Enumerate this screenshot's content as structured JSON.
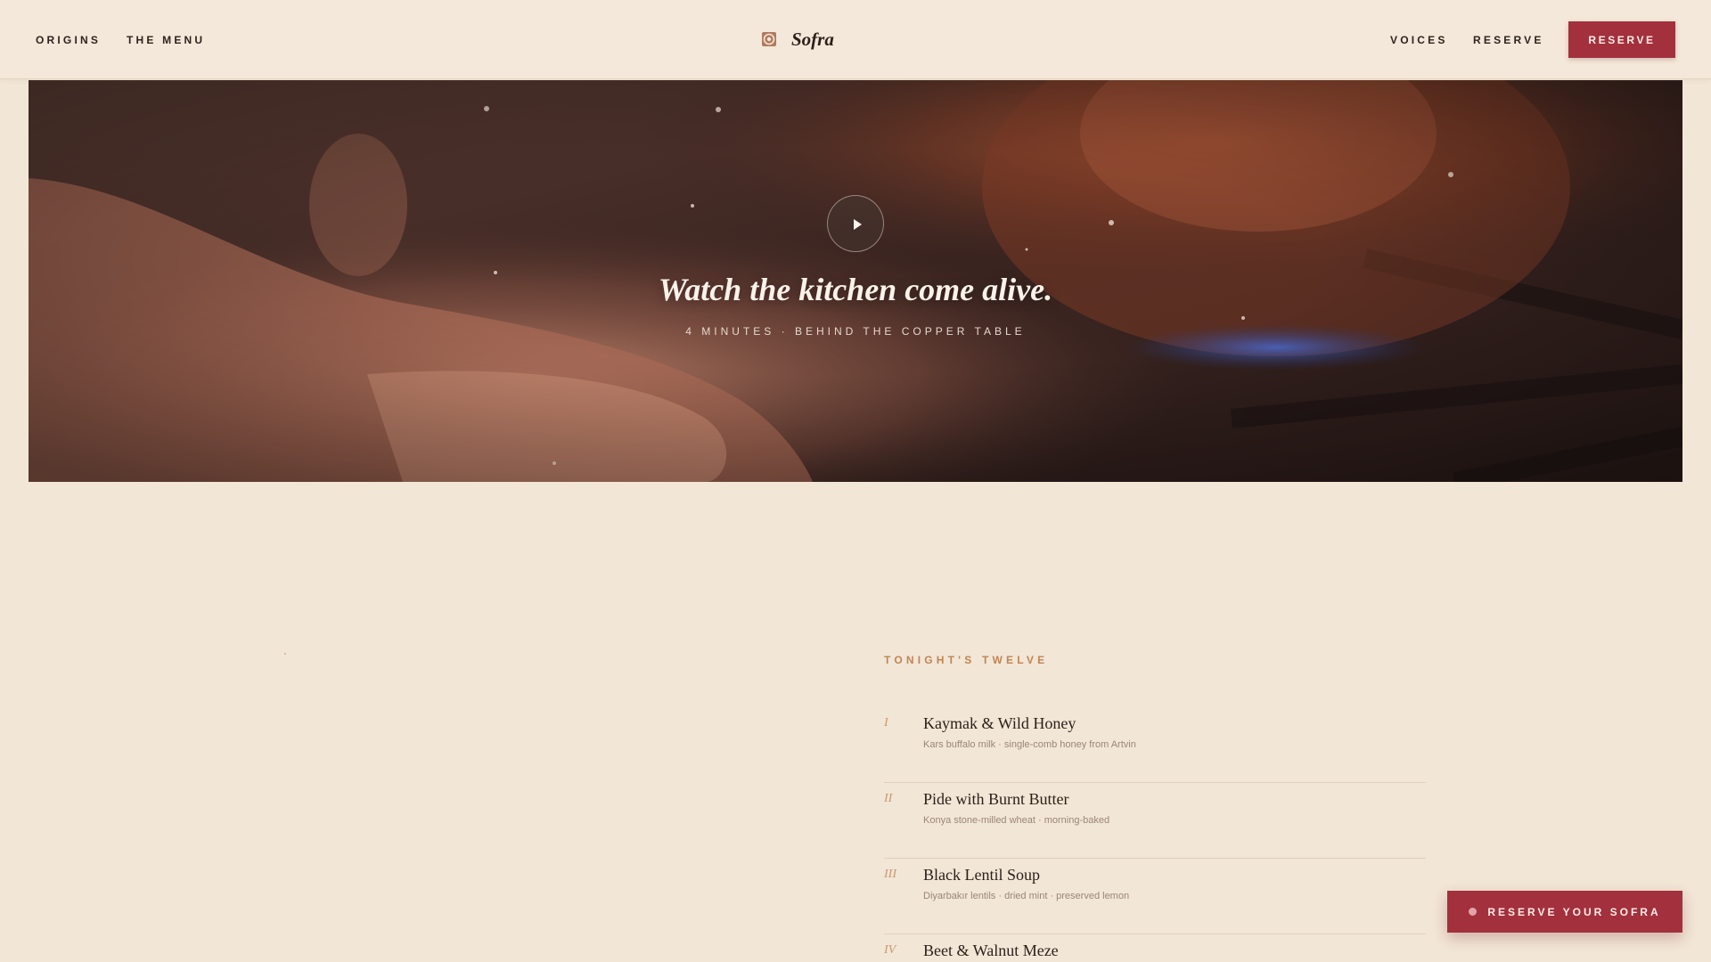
{
  "header": {
    "nav_left": [
      {
        "label": "ORIGINS"
      },
      {
        "label": "THE MENU"
      }
    ],
    "brand": {
      "name": "Sofra",
      "icon": "sofra-logo-icon"
    },
    "nav_right": [
      {
        "label": "VOICES"
      },
      {
        "label": "RESERVE"
      }
    ],
    "cta_label": "RESERVE"
  },
  "hero": {
    "title": "Watch the kitchen come alive.",
    "subtitle": "4 MINUTES · BEHIND THE COPPER TABLE",
    "play_icon": "play-icon"
  },
  "menu": {
    "eyebrow": "TONIGHT'S TWELVE",
    "items": [
      {
        "numeral": "I",
        "name": "Kaymak & Wild Honey",
        "description": "Kars buffalo milk · single-comb honey from Artvin"
      },
      {
        "numeral": "II",
        "name": "Pide with Burnt Butter",
        "description": "Konya stone-milled wheat · morning-baked"
      },
      {
        "numeral": "III",
        "name": "Black Lentil Soup",
        "description": "Diyarbakır lentils · dried mint · preserved lemon"
      },
      {
        "numeral": "IV",
        "name": "Beet & Walnut Meze",
        "description": ""
      }
    ]
  },
  "floating_cta": {
    "label": "RESERVE YOUR SOFRA"
  },
  "colors": {
    "background": "#f2e6d6",
    "accent": "#a3303d",
    "eyebrow": "#c08555",
    "text": "#2a1e18"
  }
}
